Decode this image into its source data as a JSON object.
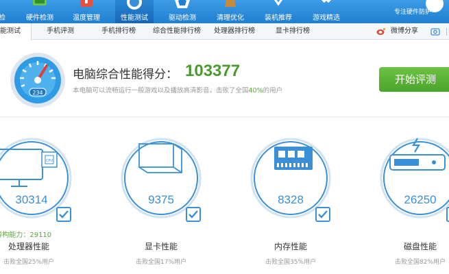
{
  "nav": {
    "items": [
      {
        "label": "检"
      },
      {
        "label": "硬件检测"
      },
      {
        "label": "温度管理"
      },
      {
        "label": "性能测试"
      },
      {
        "label": "驱动检测"
      },
      {
        "label": "清理优化"
      },
      {
        "label": "装机推荐"
      },
      {
        "label": "游戏精选"
      }
    ],
    "brand_subtitle": "专注硬件防护"
  },
  "tabs": {
    "items": [
      {
        "label": "能测试"
      },
      {
        "label": "手机评测"
      },
      {
        "label": "手机排行榜"
      },
      {
        "label": "综合性能排行榜"
      },
      {
        "label": "处理器排行榜"
      },
      {
        "label": "显卡排行榜"
      }
    ],
    "share_label": "微博分享"
  },
  "score": {
    "title": "电脑综合性能得分：",
    "value": "103377",
    "desc_prefix": "本电脑可以流畅运行一般游戏以及播放高清影音。击败了全国",
    "desc_pct": "40%",
    "desc_suffix": "的用户",
    "gauge_readout": "234",
    "start_button": "开始评测"
  },
  "components": [
    {
      "score": "30314",
      "name": "处理器性能",
      "rank": "击败全国25%用户",
      "extra": "PU异构能力：29110",
      "chip_label": "CPU"
    },
    {
      "score": "9375",
      "name": "显卡性能",
      "rank": "击败全国17%用户"
    },
    {
      "score": "8328",
      "name": "内存性能",
      "rank": "击败全国35%用户"
    },
    {
      "score": "26250",
      "name": "磁盘性能",
      "rank": "击败全国82%用户"
    }
  ],
  "colors": {
    "nav_blue": "#2a86d6",
    "accent_blue": "#3a8fd9",
    "score_green": "#4a9a2e",
    "button_green": "#5ab336"
  }
}
